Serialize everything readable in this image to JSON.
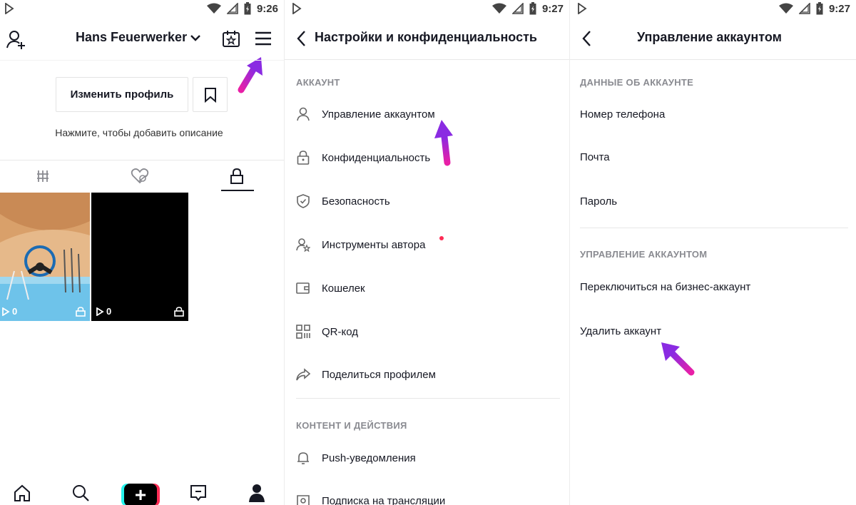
{
  "screens": {
    "profile": {
      "status_time": "9:26",
      "username": "Hans Feuerwerker",
      "edit_profile_label": "Изменить профиль",
      "bio_hint": "Нажмите, чтобы добавить описание",
      "videos": [
        {
          "views": "0"
        },
        {
          "views": "0"
        }
      ],
      "icons": {
        "add_friend": "add-user-icon",
        "calendar": "calendar-star-icon",
        "menu": "hamburger-menu-icon",
        "bookmark": "bookmark-icon"
      },
      "tabs": [
        "videos-grid-icon",
        "liked-hidden-icon",
        "private-lock-icon"
      ],
      "bottom_nav": [
        "home-icon",
        "search-icon",
        "add-icon",
        "inbox-icon",
        "profile-icon"
      ],
      "add_label": "+"
    },
    "settings": {
      "status_time": "9:27",
      "title": "Настройки и конфиденциальность",
      "section_account": "АККАУНТ",
      "items": [
        {
          "label": "Управление аккаунтом",
          "icon": "person-icon"
        },
        {
          "label": "Конфиденциальность",
          "icon": "lock-icon"
        },
        {
          "label": "Безопасность",
          "icon": "shield-icon"
        },
        {
          "label": "Инструменты автора",
          "icon": "creator-tools-icon"
        },
        {
          "label": "Кошелек",
          "icon": "wallet-icon"
        },
        {
          "label": "QR-код",
          "icon": "qr-code-icon"
        },
        {
          "label": "Поделиться профилем",
          "icon": "share-icon"
        }
      ],
      "section_content": "КОНТЕНТ И ДЕЙСТВИЯ",
      "content_items": [
        {
          "label": "Push-уведомления",
          "icon": "bell-icon"
        },
        {
          "label": "Подписка на трансляции",
          "icon": "live-icon"
        }
      ]
    },
    "account": {
      "status_time": "9:27",
      "title": "Управление аккаунтом",
      "section_data": "ДАННЫЕ ОБ АККАУНТЕ",
      "data_items": [
        "Номер телефона",
        "Почта",
        "Пароль"
      ],
      "section_manage": "УПРАВЛЕНИЕ АККАУНТОМ",
      "manage_items": [
        "Переключиться на бизнес-аккаунт",
        "Удалить аккаунт"
      ]
    }
  },
  "colors": {
    "accent_arrow": "#c81fd6",
    "notification_dot": "#fe2c55",
    "section_text": "#8a8b91"
  }
}
